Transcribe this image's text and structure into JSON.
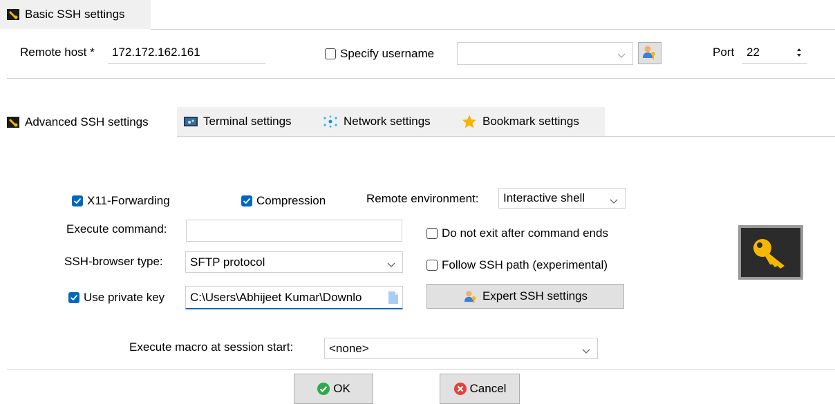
{
  "basic_tab": {
    "label": "Basic SSH settings",
    "icon": "wrench-icon"
  },
  "basic": {
    "remote_host_label": "Remote host *",
    "remote_host_value": "172.172.162.161",
    "specify_username_label": "Specify username",
    "specify_username_checked": false,
    "username_value": "",
    "port_label": "Port",
    "port_value": "22"
  },
  "advanced_tabs": [
    {
      "label": "Advanced SSH settings",
      "icon": "wrench-icon",
      "active": true
    },
    {
      "label": "Terminal settings",
      "icon": "terminal-icon",
      "active": false
    },
    {
      "label": "Network settings",
      "icon": "network-icon",
      "active": false
    },
    {
      "label": "Bookmark settings",
      "icon": "star-icon",
      "active": false
    }
  ],
  "advanced": {
    "x11_label": "X11-Forwarding",
    "x11_checked": true,
    "compression_label": "Compression",
    "compression_checked": true,
    "remote_env_label": "Remote environment:",
    "remote_env_value": "Interactive shell",
    "execute_command_label": "Execute command:",
    "execute_command_value": "",
    "no_exit_label": "Do not exit after command ends",
    "no_exit_checked": false,
    "ssh_browser_label": "SSH-browser type:",
    "ssh_browser_value": "SFTP protocol",
    "follow_path_label": "Follow SSH path (experimental)",
    "follow_path_checked": false,
    "private_key_label": "Use private key",
    "private_key_checked": true,
    "private_key_value": "C:\\Users\\Abhijeet Kumar\\Downlo",
    "expert_button": "Expert SSH settings",
    "macro_label": "Execute macro at session start:",
    "macro_value": "<none>"
  },
  "footer": {
    "ok_label": "OK",
    "cancel_label": "Cancel"
  },
  "colors": {
    "accent": "#0067c0",
    "tab_bg": "#f0f0f0",
    "ok_green": "#2eaa4a",
    "cancel_red": "#e0443b",
    "key_bg": "#2b2b2b",
    "key_gold": "#f5b800"
  }
}
